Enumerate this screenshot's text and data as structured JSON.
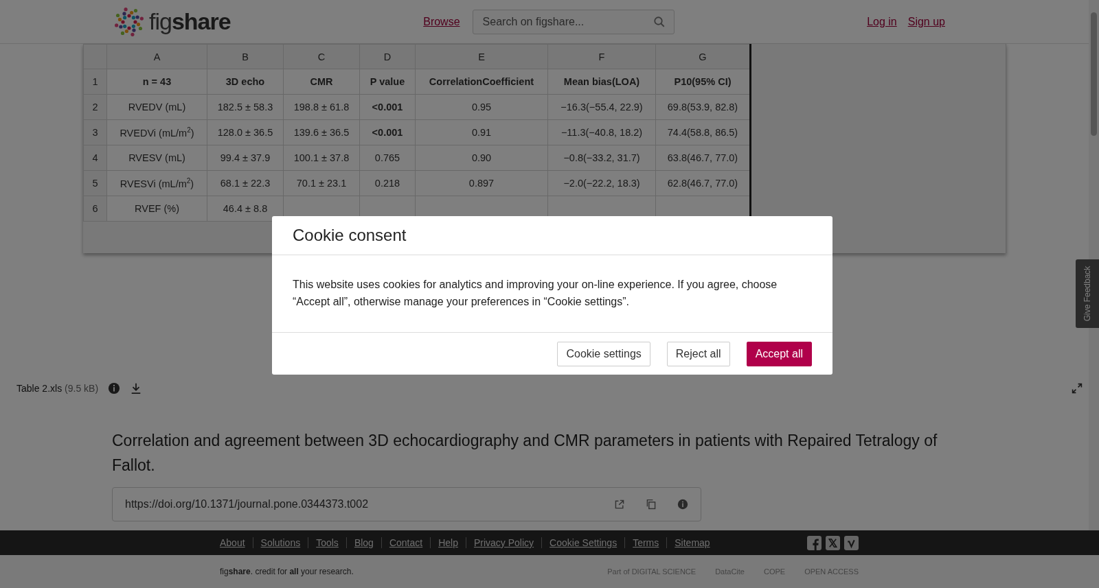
{
  "header": {
    "logo": "fig**share**",
    "browse": "Browse",
    "search": {
      "placeholder": "Search on figshare..."
    },
    "auth": [
      "Log in",
      "Sign up"
    ]
  },
  "sheet": {
    "columns": [
      "A",
      "B",
      "C",
      "D",
      "E",
      "F",
      "G"
    ],
    "rows": [
      {
        "number": "1",
        "cells": [
          {
            "text": "n = 43",
            "bold": true
          },
          {
            "text": "3D echo",
            "bold": true
          },
          {
            "text": "CMR",
            "bold": true
          },
          {
            "text": "P value",
            "bold": true
          },
          {
            "text": "CorrelationCoefficient",
            "bold": true
          },
          {
            "text": "Mean bias(LOA)",
            "bold": true
          },
          {
            "text": "P10(95% CI)",
            "bold": true
          }
        ]
      },
      {
        "number": "2",
        "cells": [
          {
            "text": "RVEDV (mL)",
            "bold": false
          },
          {
            "text": "182.5 ± 58.3",
            "bold": false
          },
          {
            "text": "198.8 ± 61.8",
            "bold": false
          },
          {
            "text": "<0.001",
            "bold": true
          },
          {
            "text": "0.95",
            "bold": false
          },
          {
            "text": "−16.3(−55.4, 22.9)",
            "bold": false
          },
          {
            "text": "69.8(53.9, 82.8)",
            "bold": false
          }
        ]
      },
      {
        "number": "3",
        "cells": [
          {
            "text": "RVEDVi (mL/m$^{2}$)",
            "bold": false
          },
          {
            "text": "128.0 ± 36.5",
            "bold": false
          },
          {
            "text": "139.6 ± 36.5",
            "bold": false
          },
          {
            "text": "<0.001",
            "bold": true
          },
          {
            "text": "0.91",
            "bold": false
          },
          {
            "text": "−11.3(−40.8, 18.2)",
            "bold": false
          },
          {
            "text": "74.4(58.8, 86.5)",
            "bold": false
          }
        ]
      },
      {
        "number": "4",
        "cells": [
          {
            "text": "RVESV (mL)",
            "bold": false
          },
          {
            "text": "99.4 ± 37.9",
            "bold": false
          },
          {
            "text": "100.1 ± 37.8",
            "bold": false
          },
          {
            "text": "0.765",
            "bold": false
          },
          {
            "text": "0.90",
            "bold": false
          },
          {
            "text": "−0.8(−33.2, 31.7)",
            "bold": false
          },
          {
            "text": "63.8(46.7, 77.0)",
            "bold": false
          }
        ]
      },
      {
        "number": "5",
        "cells": [
          {
            "text": "RVESVi (mL/m$^{2}$)",
            "bold": false
          },
          {
            "text": "68.1 ± 22.3",
            "bold": false
          },
          {
            "text": "70.1 ± 23.1",
            "bold": false
          },
          {
            "text": "0.218",
            "bold": false
          },
          {
            "text": "0.897",
            "bold": false
          },
          {
            "text": "−2.0(−22.2, 18.3)",
            "bold": false
          },
          {
            "text": "62.8(46.7, 77.0)",
            "bold": false
          }
        ]
      },
      {
        "number": "6",
        "cells": [
          {
            "text": "RVEF (%)",
            "bold": false
          },
          {
            "text": "46.4 ± 8.8",
            "bold": false
          }
        ]
      }
    ]
  },
  "file_bar": {
    "name": "Table 2.xls",
    "size": "(9.5 kB)"
  },
  "title": "Correlation and agreement between 3D echocardiography and CMR parameters in patients with Repaired Tetralogy of Fallot.",
  "doi": "https://doi.org/10.1371/journal.pone.0344373.t002",
  "feedback": "Give Feedback",
  "footer": {
    "links": [
      "About",
      "Solutions",
      "Tools",
      "Blog",
      "Contact",
      "Help",
      "Privacy Policy",
      "Cookie Settings",
      "Terms",
      "Sitemap"
    ],
    "tagline": "fig**share**. credit for **all** your research.",
    "partners": [
      "Part of DIGITAL SCIENCE",
      "DataCite",
      "COPE",
      "OPEN ACCESS"
    ]
  },
  "cookie": {
    "title": "Cookie consent",
    "body": "This website uses cookies for analytics and improving your on-line experience. If you agree, choose “Accept all”, otherwise manage your preferences in “Cookie settings”.",
    "buttons": [
      {
        "label": "Cookie settings",
        "kind": "secondary"
      },
      {
        "label": "Reject all",
        "kind": "secondary"
      },
      {
        "label": "Accept all",
        "kind": "primary"
      }
    ]
  }
}
